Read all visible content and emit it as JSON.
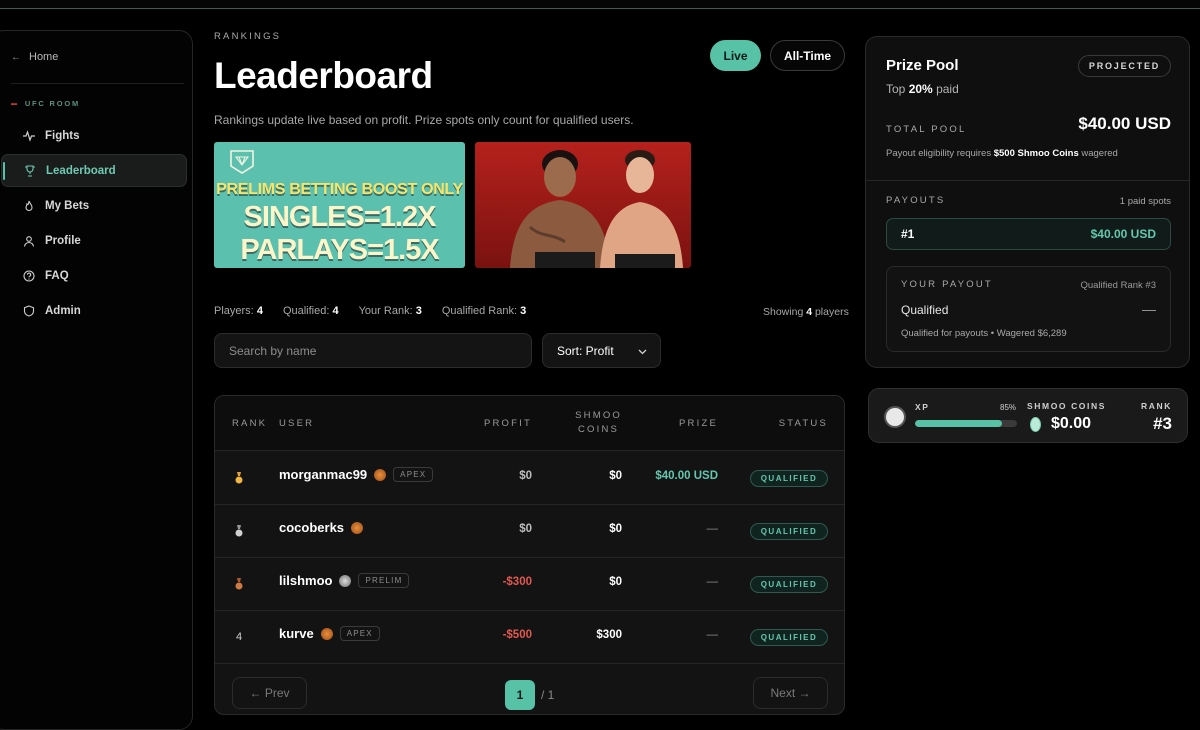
{
  "sidebar": {
    "home": "Home",
    "room": "UFC ROOM",
    "items": [
      {
        "label": "Fights",
        "icon": "activity-icon"
      },
      {
        "label": "Leaderboard",
        "icon": "trophy-icon"
      },
      {
        "label": "My Bets",
        "icon": "flame-icon"
      },
      {
        "label": "Profile",
        "icon": "user-icon"
      },
      {
        "label": "FAQ",
        "icon": "help-icon"
      },
      {
        "label": "Admin",
        "icon": "shield-icon"
      }
    ]
  },
  "header": {
    "eyebrow": "RANKINGS",
    "title": "Leaderboard",
    "subtitle": "Rankings update live based on profit. Prize spots only count for qualified users.",
    "toggle_live": "Live",
    "toggle_all": "All-Time"
  },
  "banner": {
    "line1": "PRELIMS BETTING BOOST ONLY",
    "line2": "SINGLES=1.2X",
    "line3": "PARLAYS=1.5X"
  },
  "stats": {
    "players_label": "Players:",
    "players": "4",
    "qualified_label": "Qualified:",
    "qualified": "4",
    "your_rank_label": "Your Rank:",
    "your_rank": "3",
    "qualified_rank_label": "Qualified Rank:",
    "qualified_rank": "3",
    "showing_pre": "Showing",
    "showing_count": "4",
    "showing_post": "players"
  },
  "search": {
    "placeholder": "Search by name"
  },
  "sort": {
    "label": "Sort: Profit"
  },
  "table": {
    "headers": {
      "rank": "RANK",
      "user": "USER",
      "profit": "PROFIT",
      "coins1": "SHMOO",
      "coins2": "COINS",
      "prize": "PRIZE",
      "status": "STATUS"
    },
    "rows": [
      {
        "rank": "",
        "medal": "gold",
        "user": "morganmac99",
        "tier": "APEX",
        "profit": "$0",
        "coins": "$0",
        "prize": "$40.00 USD",
        "status": "QUALIFIED"
      },
      {
        "rank": "",
        "medal": "silver",
        "user": "cocoberks",
        "tier": "",
        "profit": "$0",
        "coins": "$0",
        "prize": "—",
        "status": "QUALIFIED"
      },
      {
        "rank": "",
        "medal": "bronze",
        "user": "lilshmoo",
        "tier": "PRELIM",
        "profit": "-$300",
        "coins": "$0",
        "prize": "—",
        "status": "QUALIFIED"
      },
      {
        "rank": "4",
        "medal": "",
        "user": "kurve",
        "tier": "APEX",
        "profit": "-$500",
        "coins": "$300",
        "prize": "—",
        "status": "QUALIFIED"
      }
    ]
  },
  "pager": {
    "prev": "← Prev",
    "current": "1",
    "of": "/ 1",
    "next": "Next →"
  },
  "prize_pool": {
    "title": "Prize Pool",
    "top_pre": "Top",
    "top_pct": "20%",
    "top_post": "paid",
    "badge": "PROJECTED",
    "total_label": "TOTAL POOL",
    "total_value": "$40.00 USD",
    "note_pre": "Payout eligibility requires",
    "note_bold": "$500 Shmoo Coins",
    "note_post": "wagered",
    "payouts_label": "PAYOUTS",
    "paid_spots": "1 paid spots",
    "payout_rank": "#1",
    "payout_amount": "$40.00 USD",
    "your_payout_label": "YOUR PAYOUT",
    "your_payout_rank": "Qualified Rank #3",
    "your_payout_status": "Qualified",
    "your_payout_value": "—",
    "your_payout_note": "Qualified for payouts • Wagered $6,289"
  },
  "xp": {
    "label": "XP",
    "pct": "85%",
    "progress": 0.85,
    "coins_label": "SHMOO COINS",
    "coins_value": "$0.00",
    "rank_label": "RANK",
    "rank_value": "#3"
  },
  "colors": {
    "accent": "#57c2a6",
    "negative": "#e0584f",
    "positive": "#62c7ac"
  }
}
